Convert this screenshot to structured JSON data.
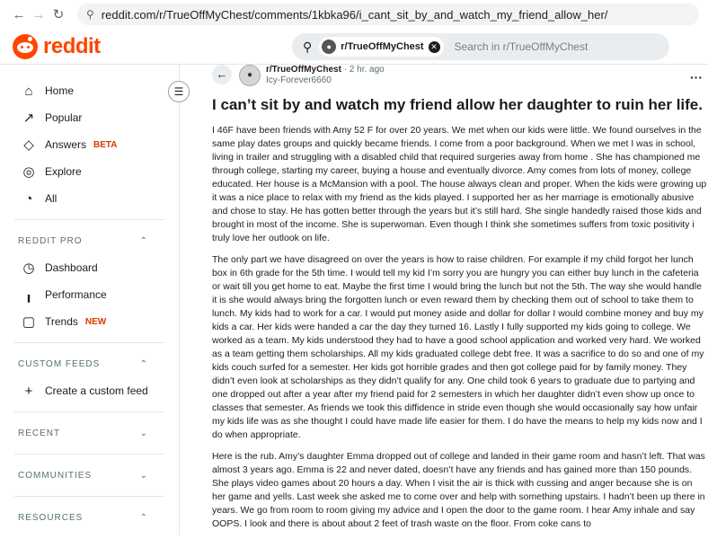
{
  "browser": {
    "back_icon": "←",
    "forward_icon": "→",
    "reload_icon": "↻",
    "site_icon": "⚲",
    "url": "reddit.com/r/TrueOffMyChest/comments/1kbka96/i_cant_sit_by_and_watch_my_friend_allow_her/"
  },
  "header": {
    "logo_text": "reddit",
    "search_chip_label": "r/TrueOffMyChest",
    "search_placeholder": "Search in r/TrueOffMyChest"
  },
  "sidebar": {
    "main_items": [
      {
        "icon": "⌂",
        "label": "Home"
      },
      {
        "icon": "↗",
        "label": "Popular"
      },
      {
        "icon": "◇",
        "label": "Answers",
        "badge": "BETA"
      },
      {
        "icon": "◎",
        "label": "Explore"
      },
      {
        "icon": "◔",
        "label": "All"
      }
    ],
    "reddit_pro": {
      "title": "REDDIT PRO",
      "chevron": "⌃",
      "items": [
        {
          "icon": "◷",
          "label": "Dashboard"
        },
        {
          "icon": "╻",
          "label": "Performance"
        },
        {
          "icon": "▢",
          "label": "Trends",
          "badge": "NEW"
        }
      ]
    },
    "custom_feeds": {
      "title": "CUSTOM FEEDS",
      "chevron": "⌃",
      "items": [
        {
          "icon": "+",
          "label": "Create a custom feed"
        }
      ]
    },
    "recent": {
      "title": "RECENT",
      "chevron": "⌄"
    },
    "communities": {
      "title": "COMMUNITIES",
      "chevron": "⌄"
    },
    "resources": {
      "title": "RESOURCES",
      "chevron": "⌃"
    }
  },
  "post": {
    "subreddit": "r/TrueOffMyChest",
    "time": "· 2 hr. ago",
    "author": "Icy-Forever6660",
    "title": "I can’t sit by and watch my friend allow her daughter to ruin her life.",
    "paragraphs": [
      "I 46F have been friends with Amy 52 F for over 20 years. We met when our kids were little. We found ourselves in the same play dates groups and quickly became friends. I come from a poor background. When we met I was in school, living in trailer and struggling with a disabled child that required surgeries away from home . She has championed me through college, starting my career, buying a house and eventually divorce. Amy comes from lots of money, college educated. Her house is a McMansion with a pool. The house always clean and proper. When the kids were growing up it was a nice place to relax with my friend as the kids played. I supported her as her marriage is emotionally abusive and chose to stay. He has gotten better through the years but it’s still hard. She single handedly raised those kids and brought in most of the income. She is superwoman. Even though I think she sometimes suffers from toxic positivity i truly love her outlook on life.",
      "The only part we have disagreed on over the years is how to raise children. For example if my child forgot her lunch box in 6th grade for the 5th time. I would tell my kid I’m sorry you are hungry you can either buy lunch in the cafeteria or wait till you get home to eat. Maybe the first time I would bring the lunch but not the 5th. The way she would handle it is she would always bring the forgotten lunch or even reward them by checking them out of school to take them to lunch. My kids had to work for a car. I would put money aside and dollar for dollar I would combine money and buy my kids a car. Her kids were handed a car the day they turned 16. Lastly I fully supported my kids going to college. We worked as a team. My kids understood they had to have a good school application and worked very hard. We worked as a team getting them scholarships. All my kids graduated college debt free. It was a sacrifice to do so and one of my kids couch surfed for a semester. Her kids got horrible grades and then got college paid for by family money. They didn’t even look at scholarships as they didn’t qualify for any. One child took 6 years to graduate due to partying and one dropped out after a year after my friend paid for 2 semesters in which her daughter didn’t even show up once to classes that semester. As friends we took this diffidence in stride even though she would occasionally say how unfair my kids life was as she thought I could have made life easier for them. I do have the means to help my kids now and I do when appropriate.",
      "Here is the rub. Amy’s daughter Emma dropped out of college and landed in their game room and hasn’t left. That was almost 3 years ago. Emma is 22 and never dated, doesn’t have any friends and has gained more than 150 pounds. She plays video games about 20 hours a day. When I visit the air is thick with cussing and anger because she is on her game and yells. Last week she asked me to come over and help with something upstairs. I hadn’t been up there in years. We go from room to room giving my advice and I open the door to the game room. I hear Amy inhale and say OOPS. I look and there is about about 2 feet of trash waste on the floor. From coke cans to"
    ]
  }
}
